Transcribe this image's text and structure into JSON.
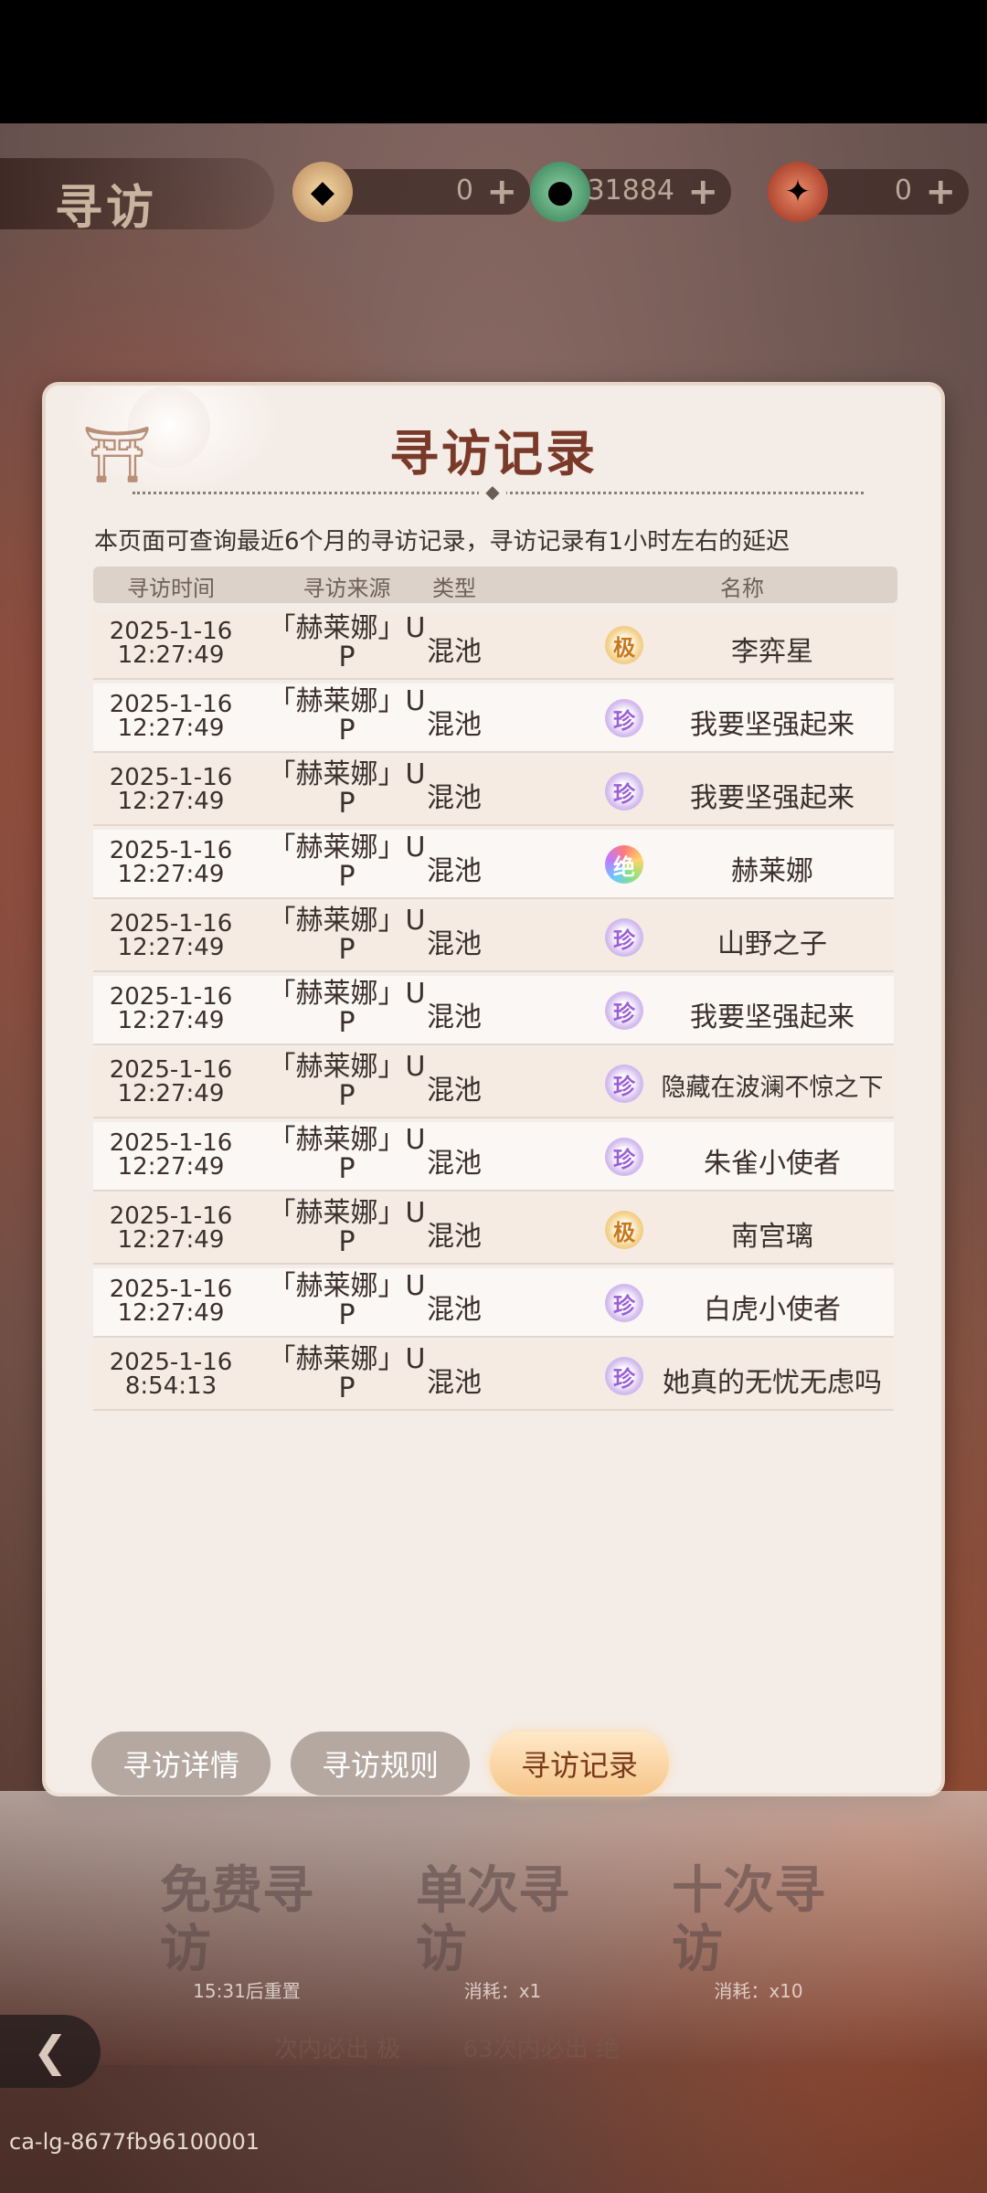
{
  "screen_title": "寻访",
  "currencies": [
    {
      "icon": "colorful-gem-icon",
      "value": "0"
    },
    {
      "icon": "jade-coin-icon",
      "value": "31884"
    },
    {
      "icon": "red-feather-ticket-icon",
      "value": "0"
    }
  ],
  "dialog": {
    "title": "寻访记录",
    "notice": "本页面可查询最近6个月的寻访记录，寻访记录有1小时左右的延迟",
    "headers": [
      "寻访时间",
      "寻访来源",
      "类型",
      "名称"
    ],
    "records": [
      {
        "time": "2025-1-16\n12:27:49",
        "source": "「赫莱娜」UP",
        "type": "混池",
        "rarity": "极",
        "name": "李弈星"
      },
      {
        "time": "2025-1-16\n12:27:49",
        "source": "「赫莱娜」UP",
        "type": "混池",
        "rarity": "珍",
        "name": "我要坚强起来"
      },
      {
        "time": "2025-1-16\n12:27:49",
        "source": "「赫莱娜」UP",
        "type": "混池",
        "rarity": "珍",
        "name": "我要坚强起来"
      },
      {
        "time": "2025-1-16\n12:27:49",
        "source": "「赫莱娜」UP",
        "type": "混池",
        "rarity": "绝",
        "name": "赫莱娜"
      },
      {
        "time": "2025-1-16\n12:27:49",
        "source": "「赫莱娜」UP",
        "type": "混池",
        "rarity": "珍",
        "name": "山野之子"
      },
      {
        "time": "2025-1-16\n12:27:49",
        "source": "「赫莱娜」UP",
        "type": "混池",
        "rarity": "珍",
        "name": "我要坚强起来"
      },
      {
        "time": "2025-1-16\n12:27:49",
        "source": "「赫莱娜」UP",
        "type": "混池",
        "rarity": "珍",
        "name": "隐藏在波澜不惊之下"
      },
      {
        "time": "2025-1-16\n12:27:49",
        "source": "「赫莱娜」UP",
        "type": "混池",
        "rarity": "珍",
        "name": "朱雀小使者"
      },
      {
        "time": "2025-1-16\n12:27:49",
        "source": "「赫莱娜」UP",
        "type": "混池",
        "rarity": "极",
        "name": "南宫璃"
      },
      {
        "time": "2025-1-16\n12:27:49",
        "source": "「赫莱娜」UP",
        "type": "混池",
        "rarity": "珍",
        "name": "白虎小使者"
      },
      {
        "time": "2025-1-16\n8:54:13",
        "source": "「赫莱娜」UP",
        "type": "混池",
        "rarity": "珍",
        "name": "她真的无忧无虑吗"
      }
    ],
    "tabs": [
      {
        "label": "寻访详情",
        "active": false
      },
      {
        "label": "寻访规则",
        "active": false
      },
      {
        "label": "寻访记录",
        "active": true
      }
    ]
  },
  "bottom": {
    "free": {
      "label": "免费寻访",
      "sub": "15:31后重置"
    },
    "single": {
      "label": "单次寻访",
      "sub": "消耗：x1"
    },
    "ten": {
      "label": "十次寻访",
      "sub": "消耗：x10"
    },
    "guarantee_left": "次内必出",
    "guarantee_left_badge": "极",
    "guarantee_right": "63次内必出",
    "guarantee_right_badge": "绝"
  },
  "device_id": "ca-lg-8677fb96100001",
  "colors": {
    "accent": "#7a3a2a",
    "dialog_bg": "#f4ece6",
    "active_tab": "#f6c58a"
  }
}
